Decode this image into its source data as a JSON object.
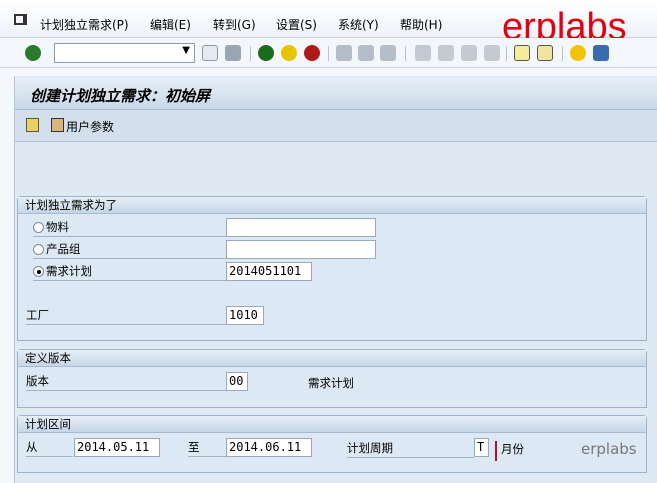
{
  "menu": {
    "items": [
      "计划独立需求(P)",
      "编辑(E)",
      "转到(G)",
      "设置(S)",
      "系统(Y)",
      "帮助(H)"
    ]
  },
  "watermark": {
    "brand": "erplabs",
    "bottom": "erplabs"
  },
  "toolbar": {
    "command_value": ""
  },
  "title": "创建计划独立需求：初始屏",
  "app_toolbar": {
    "user_params": "用户参数"
  },
  "group1": {
    "header": "计划独立需求为了",
    "material": "物料",
    "material_value": "",
    "product_group": "产品组",
    "product_group_value": "",
    "plan": "需求计划",
    "plan_value": "2014051101",
    "plant": "工厂",
    "plant_value": "1010"
  },
  "group2": {
    "header": "定义版本",
    "version": "版本",
    "version_value": "00",
    "version_desc": "需求计划"
  },
  "group3": {
    "header": "计划区间",
    "from": "从",
    "from_value": "2014.05.11",
    "to": "至",
    "to_value": "2014.06.11",
    "period": "计划周期",
    "period_value": "T",
    "period_desc": "月份"
  }
}
